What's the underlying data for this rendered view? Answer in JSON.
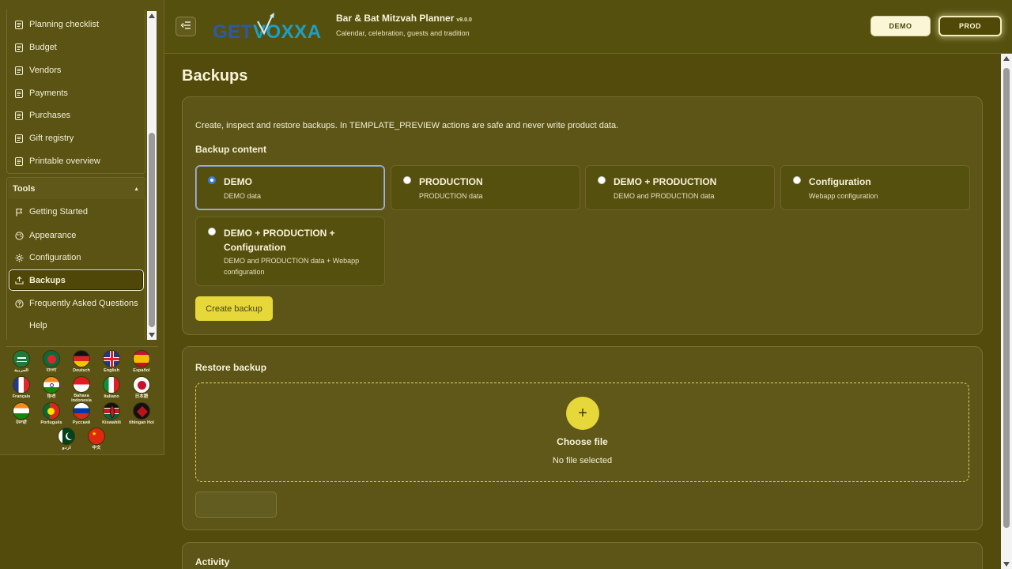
{
  "sidebar": {
    "items": [
      {
        "label": "Planning checklist",
        "icon": "document-icon"
      },
      {
        "label": "Budget",
        "icon": "document-icon"
      },
      {
        "label": "Vendors",
        "icon": "document-icon"
      },
      {
        "label": "Payments",
        "icon": "document-icon"
      },
      {
        "label": "Purchases",
        "icon": "document-icon"
      },
      {
        "label": "Gift registry",
        "icon": "document-icon"
      },
      {
        "label": "Printable overview",
        "icon": "document-icon"
      }
    ],
    "tools_label": "Tools",
    "tools": [
      {
        "label": "Getting Started",
        "icon": "flag-icon"
      },
      {
        "label": "Appearance",
        "icon": "palette-icon"
      },
      {
        "label": "Configuration",
        "icon": "gear-icon"
      },
      {
        "label": "Backups",
        "icon": "upload-icon",
        "active": true
      },
      {
        "label": "Frequently Asked Questions",
        "icon": "question-icon"
      },
      {
        "label": "Help",
        "icon": ""
      }
    ],
    "languages": [
      {
        "label": "العربية"
      },
      {
        "label": "বাংলা"
      },
      {
        "label": "Deutsch"
      },
      {
        "label": "English"
      },
      {
        "label": "Español"
      },
      {
        "label": "Français"
      },
      {
        "label": "हिन्दी"
      },
      {
        "label": "Bahasa Indonesia"
      },
      {
        "label": "Italiano"
      },
      {
        "label": "日本語"
      },
      {
        "label": "ਪੰਜਾਬੀ"
      },
      {
        "label": "Português"
      },
      {
        "label": "Русский"
      },
      {
        "label": "Kiswahili"
      },
      {
        "label": "tlhIngan Hol"
      },
      {
        "label": "اردو"
      },
      {
        "label": "中文"
      }
    ]
  },
  "header": {
    "logo_text": "GETVOXXA",
    "title": "Bar & Bat Mitzvah Planner",
    "version": "v9.0.0",
    "subtitle": "Calendar, celebration, guests and tradition",
    "demo_label": "DEMO",
    "prod_label": "PROD"
  },
  "main": {
    "page_title": "Backups",
    "description": "Create, inspect and restore backups. In TEMPLATE_PREVIEW actions are safe and never write product data.",
    "content_title": "Backup content",
    "options": [
      {
        "title": "DEMO",
        "subtitle": "DEMO data",
        "selected": true
      },
      {
        "title": "PRODUCTION",
        "subtitle": "PRODUCTION data",
        "selected": false
      },
      {
        "title": "DEMO + PRODUCTION",
        "subtitle": "DEMO and PRODUCTION data",
        "selected": false
      },
      {
        "title": "Configuration",
        "subtitle": "Webapp configuration",
        "selected": false
      },
      {
        "title": "DEMO + PRODUCTION + Configuration",
        "subtitle": "DEMO and PRODUCTION data + Webapp configuration",
        "selected": false
      }
    ],
    "create_label": "Create backup",
    "restore_title": "Restore backup",
    "choose_file": "Choose file",
    "no_file": "No file selected",
    "activity_title": "Activity"
  },
  "colors": {
    "background": "#524b0b",
    "accent": "#e6d83a",
    "radio_selected": "#3d7bd9"
  }
}
